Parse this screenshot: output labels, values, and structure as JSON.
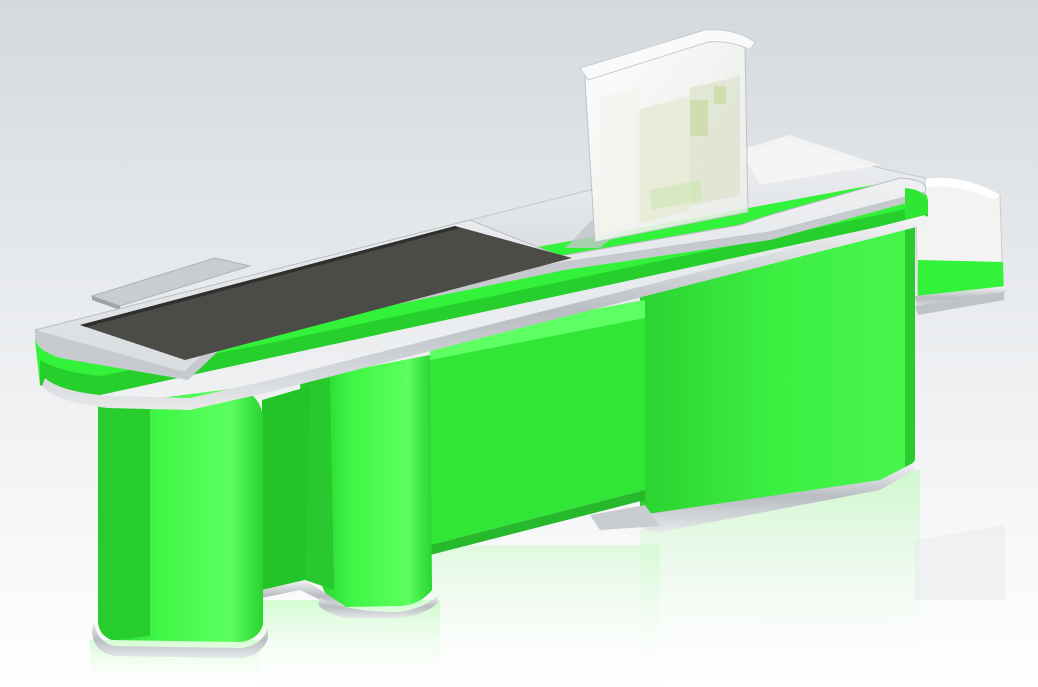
{
  "scene": {
    "subject": "checkout-counter",
    "colors": {
      "body_green": "#33f23a",
      "body_green_dark": "#22c428",
      "body_green_light": "#7dff74",
      "trim_silver": "#d4d7db",
      "trim_dark": "#9ea3a9",
      "countertop": "#e7e9ec",
      "belt": "#4b4c48",
      "acrylic": "#f2f4ef",
      "background_top": "#d4d9de",
      "background_bottom": "#ffffff"
    }
  }
}
